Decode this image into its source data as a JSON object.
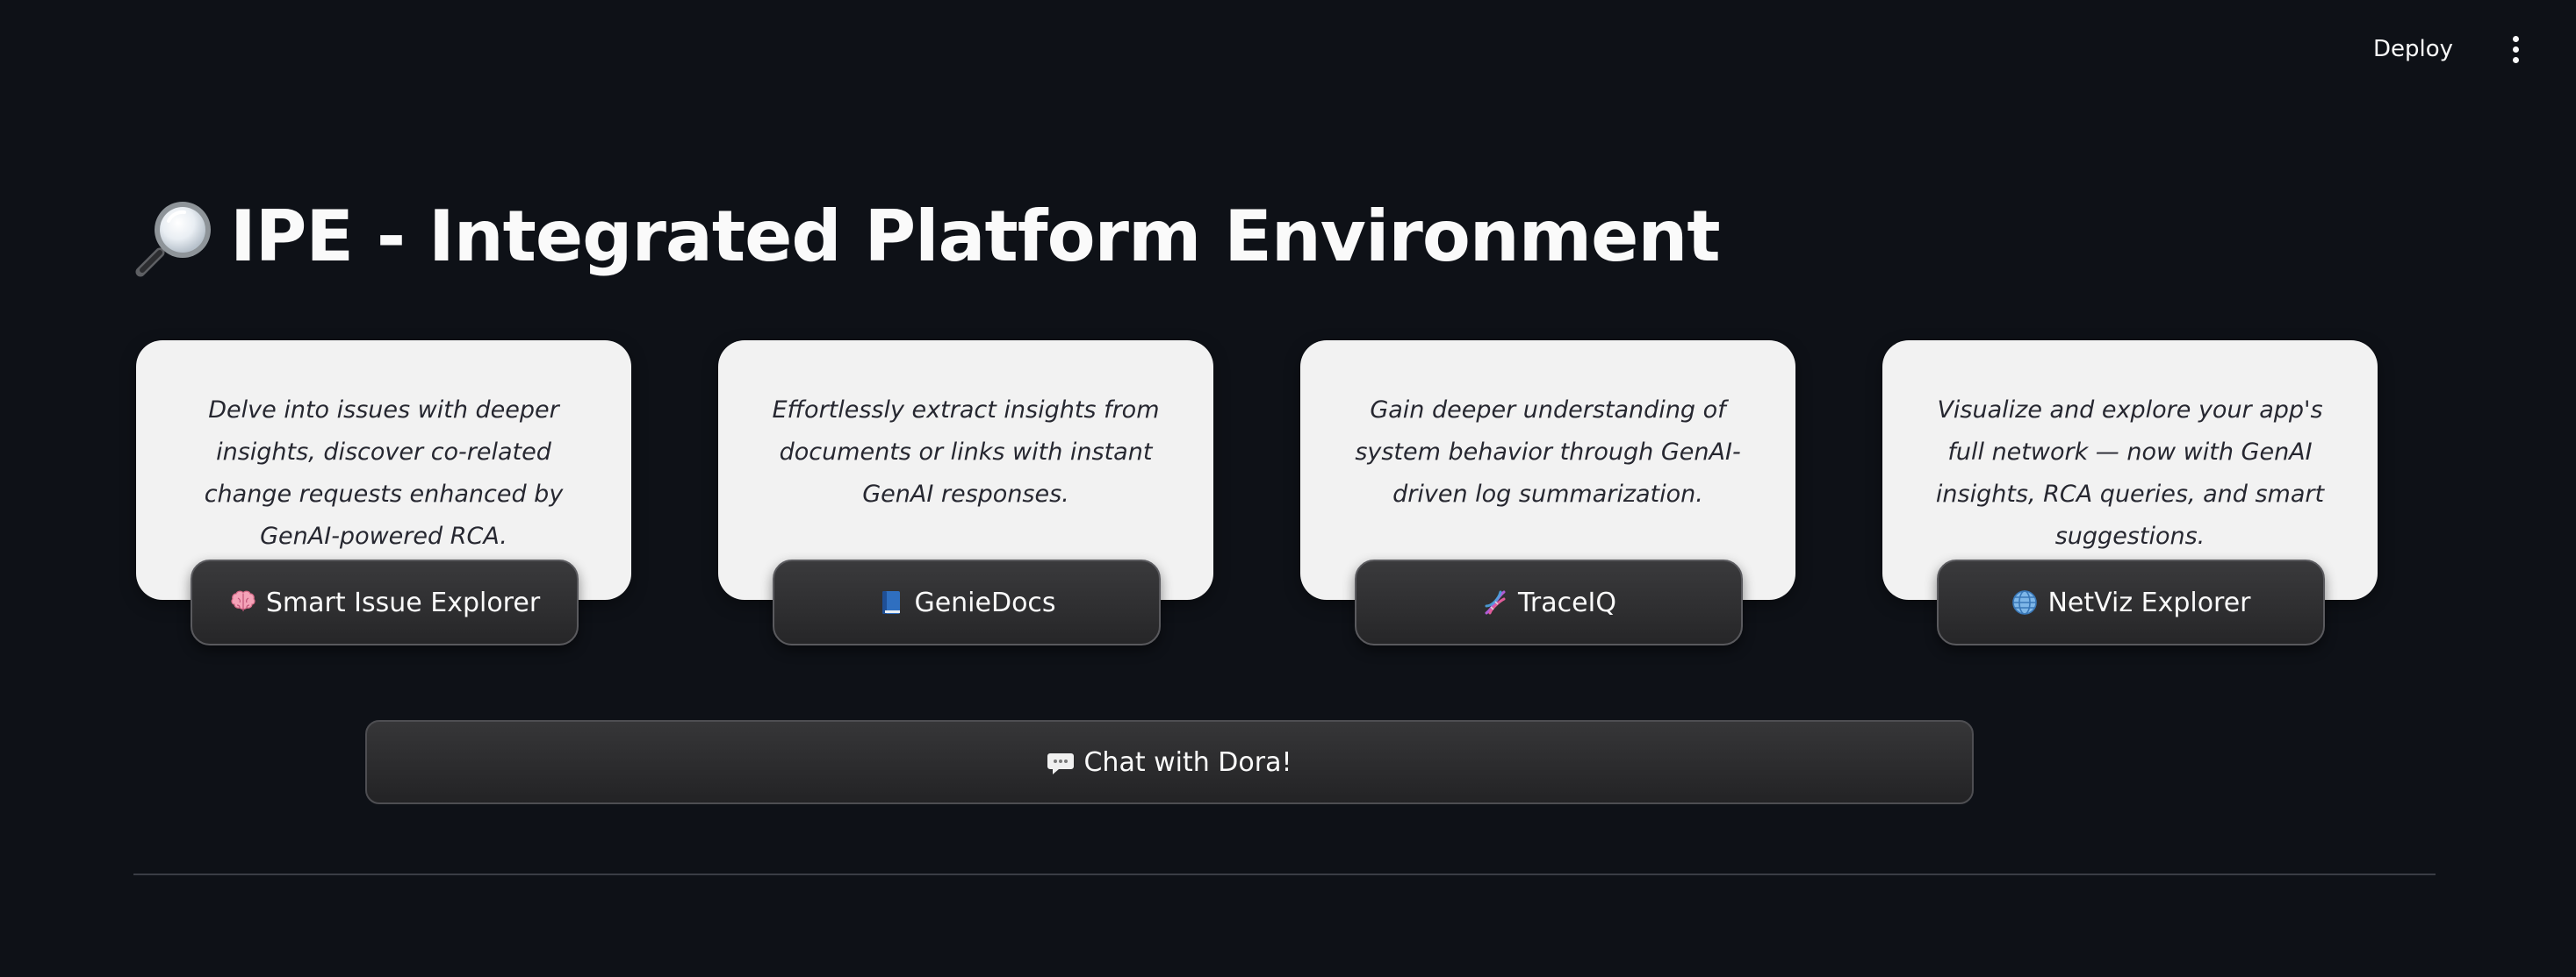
{
  "header": {
    "deploy_label": "Deploy",
    "menu_icon": "more-vertical-icon"
  },
  "page": {
    "title_icon": "magnifying-glass-icon",
    "title": "IPE - Integrated Platform Environment"
  },
  "cards": [
    {
      "description": "Delve into issues with deeper insights, discover co-related change requests enhanced by GenAI-powered RCA.",
      "button_icon": "brain-icon",
      "button_label": "Smart Issue Explorer"
    },
    {
      "description": "Effortlessly extract insights from documents or links with instant GenAI responses.",
      "button_icon": "book-icon",
      "button_label": "GenieDocs"
    },
    {
      "description": "Gain deeper understanding of system behavior through GenAI-driven log summarization.",
      "button_icon": "dna-icon",
      "button_label": "TraceIQ"
    },
    {
      "description": "Visualize and explore your app's full network — now with GenAI insights, RCA queries, and smart suggestions.",
      "button_icon": "globe-icon",
      "button_label": "NetViz Explorer"
    }
  ],
  "chat": {
    "icon": "speech-bubble-icon",
    "label": "Chat with Dora!"
  },
  "colors": {
    "background": "#0e1117",
    "card_background": "#f2f2f2",
    "button_background": "#2e2e30",
    "text": "#fafafa",
    "card_text": "#262730"
  }
}
